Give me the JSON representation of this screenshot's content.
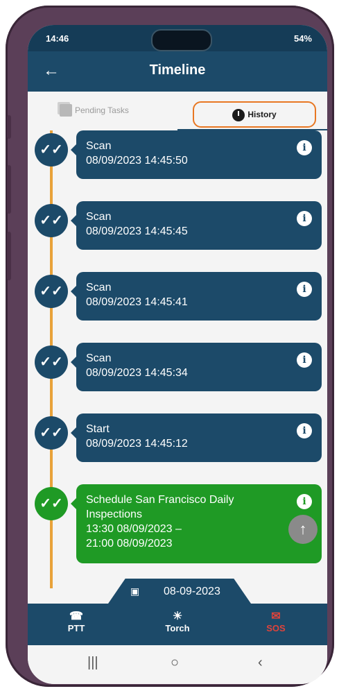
{
  "status": {
    "time": "14:46",
    "battery": "54%"
  },
  "appbar": {
    "back_icon": "arrow-left-icon",
    "title": "Timeline"
  },
  "tabs": {
    "pending": "Pending Tasks",
    "history": "History"
  },
  "timeline": [
    {
      "title": "Scan",
      "line2": "08/09/2023 14:45:50",
      "color": "#1c4a69"
    },
    {
      "title": "Scan",
      "line2": "08/09/2023 14:45:45",
      "color": "#1c4a69"
    },
    {
      "title": "Scan",
      "line2": "08/09/2023 14:45:41",
      "color": "#1c4a69"
    },
    {
      "title": "Scan",
      "line2": "08/09/2023 14:45:34",
      "color": "#1c4a69"
    },
    {
      "title": "Start",
      "line2": "08/09/2023 14:45:12",
      "color": "#1c4a69"
    },
    {
      "title": "Schedule San Francisco Daily Inspections",
      "line2": "13:30 08/09/2023 –",
      "line3": "21:00 08/09/2023",
      "color": "#1f9a25"
    }
  ],
  "date_tab": {
    "date": "08-09-2023"
  },
  "bottomnav": {
    "ptt": "PTT",
    "torch": "Torch",
    "sos": "SOS"
  },
  "colors": {
    "primary": "#1c4a69",
    "accent": "#e87722",
    "success": "#1f9a25",
    "sos": "#e0433b"
  }
}
